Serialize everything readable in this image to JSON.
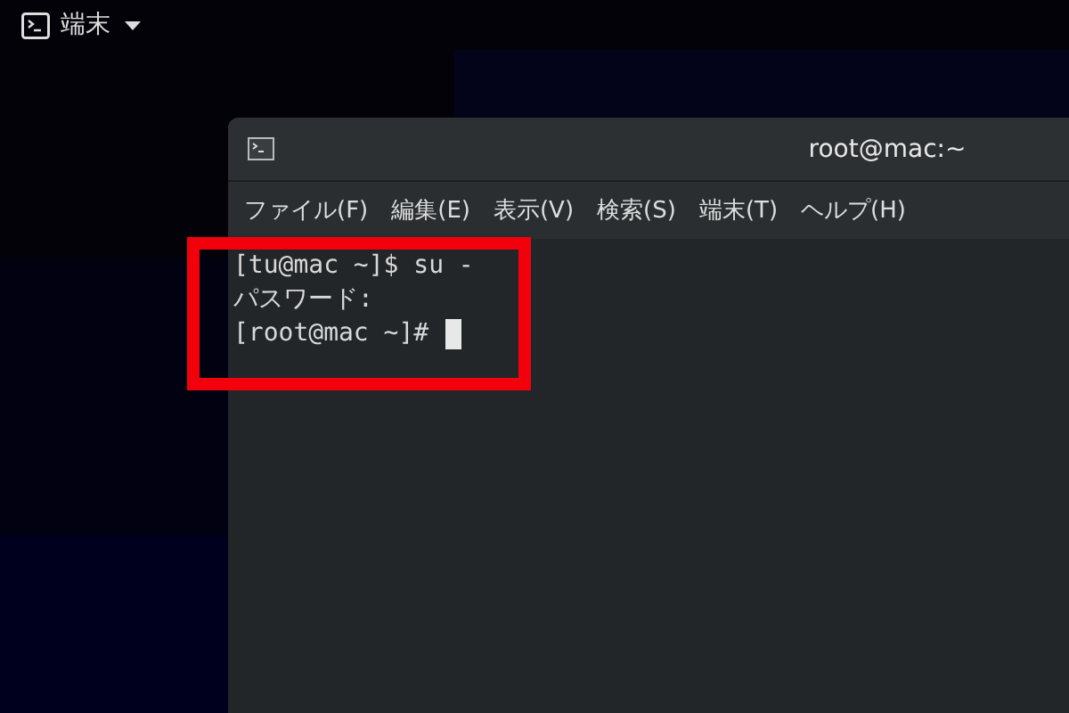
{
  "top_bar": {
    "app_menu": "端末"
  },
  "window": {
    "title": "root@mac:~"
  },
  "menu": [
    "ファイル(F)",
    "編集(E)",
    "表示(V)",
    "検索(S)",
    "端末(T)",
    "ヘルプ(H)"
  ],
  "terminal": {
    "lines": [
      {
        "text": "[tu@mac ~]$ su -",
        "cursor": false
      },
      {
        "text": "パスワード:",
        "cursor": false
      },
      {
        "text": "[root@mac ~]# ",
        "cursor": true
      }
    ]
  }
}
